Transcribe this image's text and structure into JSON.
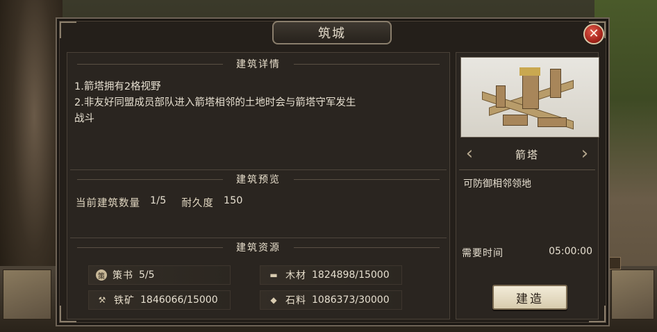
{
  "window": {
    "title": "筑城"
  },
  "details": {
    "heading": "建筑详情",
    "lines": [
      "1.箭塔拥有2格视野",
      "2.非友好同盟成员部队进入箭塔相邻的土地时会与箭塔守军发生",
      "战斗"
    ]
  },
  "preview": {
    "heading": "建筑预览",
    "count_label": "当前建筑数量",
    "count_value": "1/5",
    "durability_label": "耐久度",
    "durability_value": "150"
  },
  "resources": {
    "heading": "建筑资源",
    "items": [
      {
        "name": "策书",
        "value": "5/5",
        "icon": "scroll-badge-icon",
        "icon_glyph": "策"
      },
      {
        "name": "铁矿",
        "value": "1846066/15000",
        "icon": "iron-anvil-icon",
        "icon_glyph": "⚒"
      },
      {
        "name": "木材",
        "value": "1824898/15000",
        "icon": "timber-icon",
        "icon_glyph": "▬"
      },
      {
        "name": "石料",
        "value": "1086373/30000",
        "icon": "stone-icon",
        "icon_glyph": "◆"
      }
    ]
  },
  "building": {
    "name": "箭塔",
    "description": "可防御相邻领地",
    "time_label": "需要时间",
    "time_value": "05:00:00",
    "build_label": "建造"
  },
  "colors": {
    "panel_bg": "#2a2520",
    "text": "#e6dfd0",
    "close_red": "#a8261c",
    "button_bg": "#f2ebd8"
  }
}
